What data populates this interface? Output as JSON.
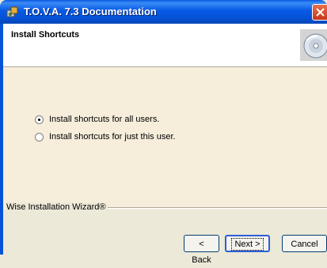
{
  "window": {
    "title": "T.O.V.A. 7.3 Documentation"
  },
  "header": {
    "title": "Install Shortcuts"
  },
  "options": [
    {
      "label": "Install shortcuts for all users.",
      "checked": true
    },
    {
      "label": "Install shortcuts for just this user.",
      "checked": false
    }
  ],
  "footer": {
    "brand": "Wise Installation Wizard®",
    "back_label": "< Back",
    "next_label": "Next >",
    "cancel_label": "Cancel"
  },
  "colors": {
    "titlebar": "#0552d6",
    "content_bg": "#f6eddb",
    "dialog_bg": "#ece9d8",
    "close_button": "#d9532c"
  },
  "icons": {
    "window": "installer-icon",
    "header": "cd-disc-icon",
    "close": "close-icon"
  }
}
